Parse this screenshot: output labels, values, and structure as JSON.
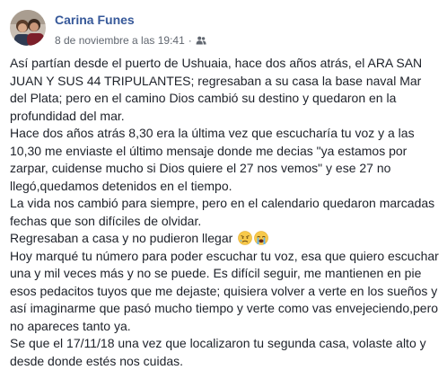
{
  "post": {
    "author": {
      "name": "Carina Funes"
    },
    "timestamp": "8 de noviembre a las 19:41",
    "separator": "·",
    "audience_icon": "friends-icon",
    "paragraphs": [
      "Así partían desde el puerto de Ushuaia, hace dos años atrás, el ARA SAN JUAN Y SUS 44 TRIPULANTES; regresaban a su casa la base naval Mar del Plata; pero en el camino Dios cambió su destino y quedaron en la profundidad del mar.",
      "Hace dos años atrás 8,30 era la última vez que escucharía tu voz y a las 10,30 me enviaste el último mensaje donde me decias \"ya estamos por zarpar, cuidense mucho si Dios quiere el 27 nos vemos\" y ese 27 no llegó,quedamos detenidos en el tiempo.",
      "La vida nos cambió para siempre, pero en el calendario quedaron marcadas fechas que son difíciles de olvidar.",
      "Regresaban a casa y no pudieron llegar",
      "Hoy marqué tu número para poder escuchar tu voz, esa que quiero escuchar una y mil veces más y no se puede. Es difícil seguir, me mantienen en pie esos pedacitos tuyos que me dejaste; quisiera volver a verte en los sueños y así imaginarme que pasó mucho tiempo y verte como vas envejeciendo,pero no apareces tanto ya.",
      "Se que el 17/11/18 una vez que localizaron tu segunda casa, volaste alto y desde donde estés nos cuidas."
    ],
    "emojis": [
      "sad-but-relieved-face-emoji",
      "loudly-crying-face-emoji"
    ]
  }
}
